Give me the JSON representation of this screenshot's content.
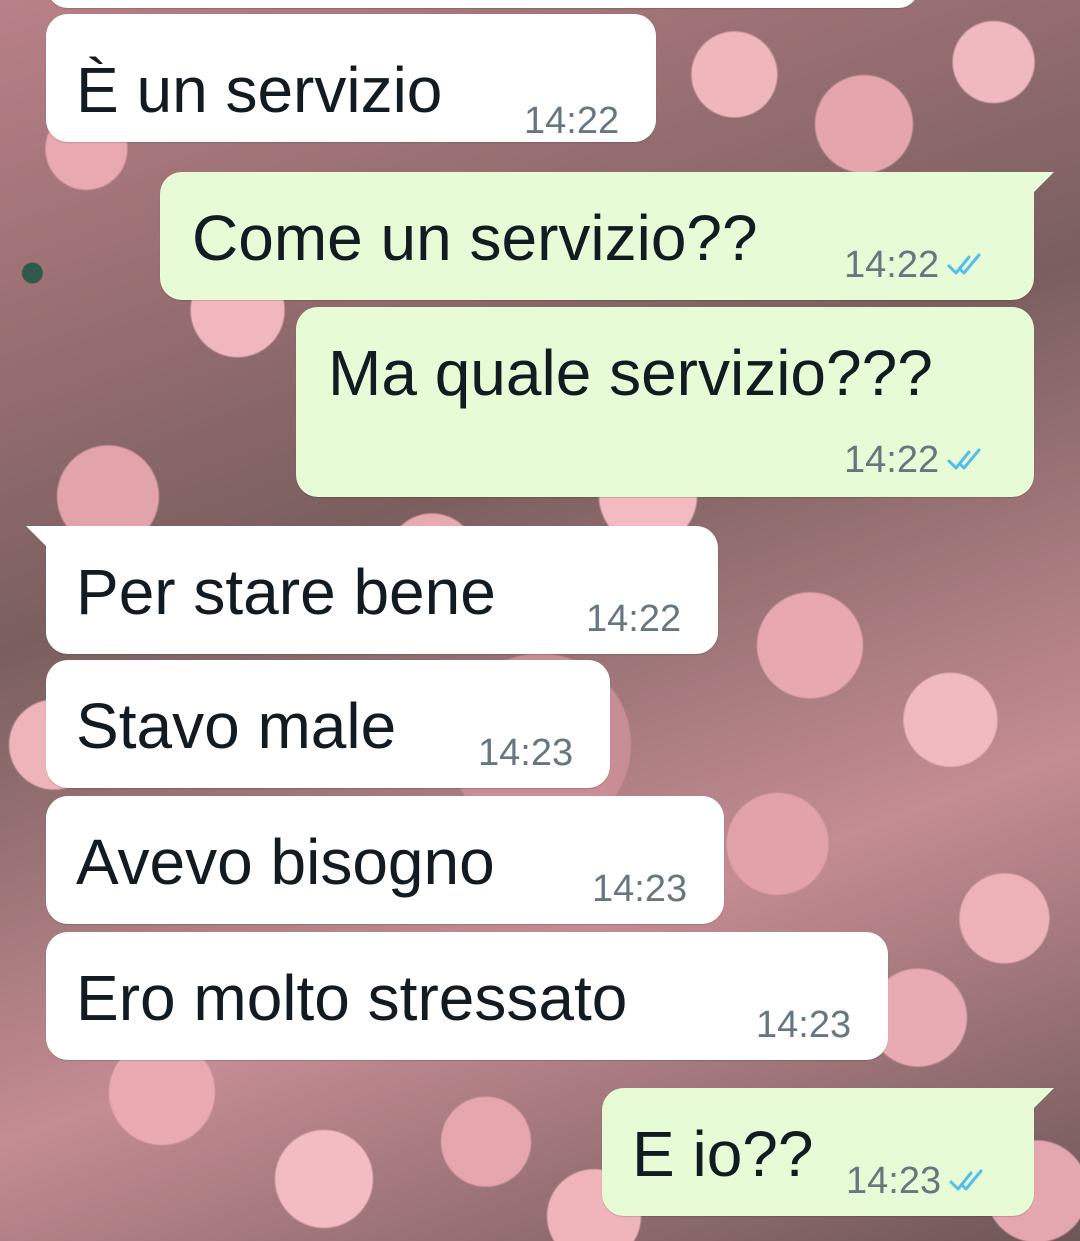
{
  "messages": [
    {
      "direction": "incoming",
      "text": "È un servizio",
      "time": "14:22"
    },
    {
      "direction": "outgoing",
      "text": "Come un servizio??",
      "time": "14:22",
      "status": "read"
    },
    {
      "direction": "outgoing",
      "text": "Ma quale servizio???",
      "time": "14:22",
      "status": "read"
    },
    {
      "direction": "incoming",
      "text": "Per stare bene",
      "time": "14:22"
    },
    {
      "direction": "incoming",
      "text": "Stavo male",
      "time": "14:23"
    },
    {
      "direction": "incoming",
      "text": "Avevo bisogno",
      "time": "14:23"
    },
    {
      "direction": "incoming",
      "text": "Ero molto stressato",
      "time": "14:23"
    },
    {
      "direction": "outgoing",
      "text": "E io??",
      "time": "14:23",
      "status": "read"
    }
  ],
  "colors": {
    "incoming_bubble": "#ffffff",
    "outgoing_bubble": "#e7fcd6",
    "text": "#111b21",
    "time": "#667781",
    "read_check": "#53bdeb"
  },
  "icons": {
    "read_receipt": "double-check-icon"
  }
}
